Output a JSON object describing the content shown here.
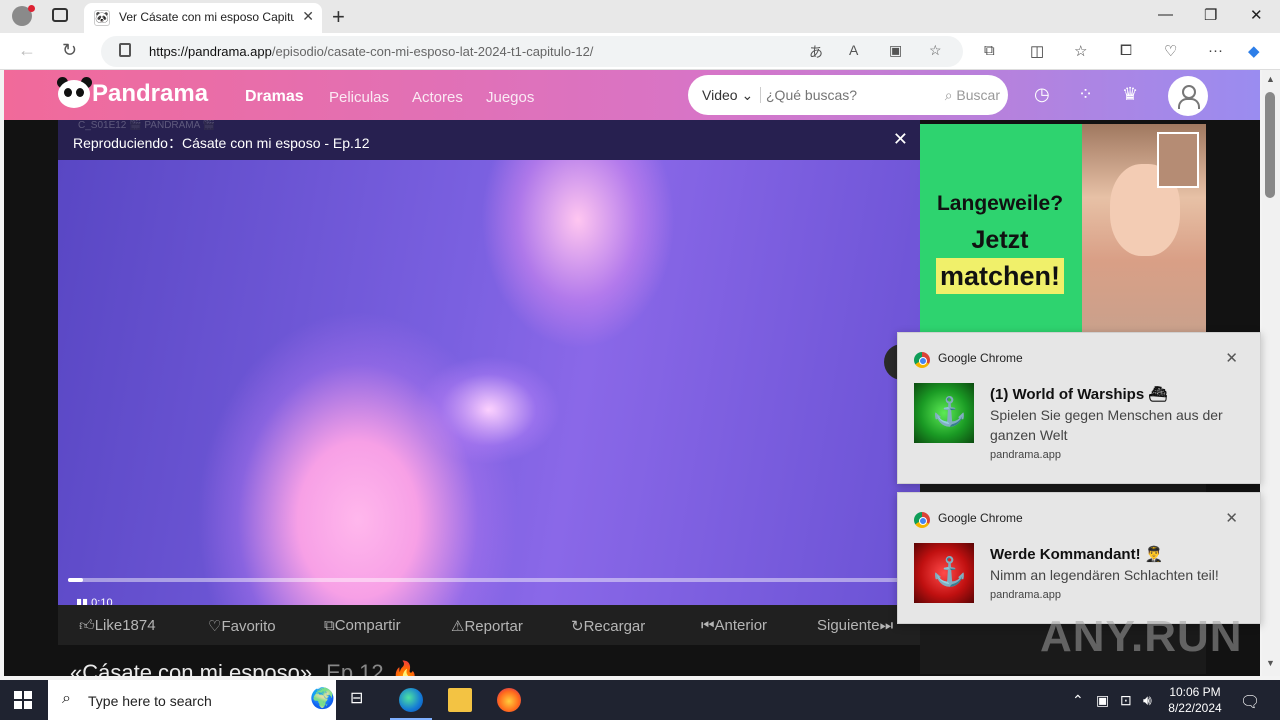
{
  "browser": {
    "tab_title": "Ver Cásate con mi esposo Capitul",
    "url_host": "https://pandrama.app",
    "url_path": "/episodio/casate-con-mi-esposo-lat-2024-t1-capitulo-12/"
  },
  "site": {
    "logo": "Pandrama",
    "nav": [
      "Dramas",
      "Peliculas",
      "Actores",
      "Juegos"
    ],
    "search_select": "Video",
    "search_placeholder": "¿Qué buscas?",
    "search_button": "Buscar"
  },
  "player": {
    "watermark": "C_S01E12 🎬 PANDRAMA 🎬",
    "now_playing": "Reproduciendo：Cásate con mi esposo - Ep.12",
    "time": "0:10",
    "progress": 0.018
  },
  "actions": [
    {
      "icon": "thumb-up-icon",
      "label": "Like1874"
    },
    {
      "icon": "heart-icon",
      "label": "Favorito"
    },
    {
      "icon": "share-icon",
      "label": "Compartir"
    },
    {
      "icon": "warning-icon",
      "label": "Reportar"
    },
    {
      "icon": "reload-icon",
      "label": "Recargar"
    },
    {
      "icon": "previous-icon",
      "label": "Anterior"
    },
    {
      "icon": "next-icon",
      "label": "Siguiente"
    }
  ],
  "below_title": {
    "title": "«Cásate con mi esposo»",
    "ep": "Ep.12",
    "hot": "🔥"
  },
  "ad": {
    "line1": "Langeweile?",
    "line2": "Jetzt",
    "line3": "matchen!"
  },
  "notifications": [
    {
      "app": "Google Chrome",
      "title": "(1) World of Warships ⛴",
      "body": "Spielen Sie gegen Menschen aus der ganzen Welt",
      "source": "pandrama.app",
      "color": "#1a9a24"
    },
    {
      "app": "Google Chrome",
      "title": "Werde Kommandant! 👨‍✈️",
      "body": "Nimm an legendären Schlachten teil!",
      "source": "pandrama.app",
      "color": "#c01010"
    }
  ],
  "watermark": "ANY.RUN",
  "taskbar": {
    "search_placeholder": "Type here to search",
    "time": "10:06 PM",
    "date": "8/22/2024"
  }
}
